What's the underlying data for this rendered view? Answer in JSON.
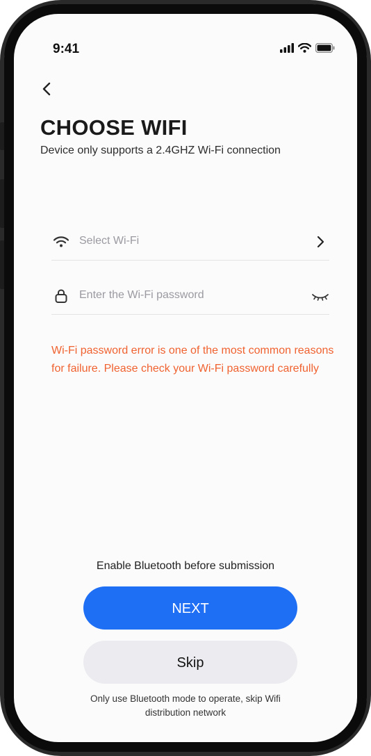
{
  "status_bar": {
    "time": "9:41",
    "icons": [
      "cellular-signal-icon",
      "wifi-icon",
      "battery-icon"
    ]
  },
  "header": {
    "back_icon": "chevron-left-icon",
    "title": "CHOOSE WIFI",
    "subtitle": "Device only supports a 2.4GHZ Wi-Fi connection"
  },
  "form": {
    "wifi_field": {
      "icon": "wifi-icon",
      "placeholder": "Select Wi-Fi",
      "right_icon": "chevron-right-icon"
    },
    "password_field": {
      "icon": "lock-icon",
      "placeholder": "Enter the Wi-Fi password",
      "right_icon": "eye-closed-icon"
    },
    "warning": "Wi-Fi password error is one of the most common reasons for failure. Please check your Wi-Fi password carefully"
  },
  "footer": {
    "bluetooth_note": "Enable Bluetooth before submission",
    "next_label": "NEXT",
    "skip_label": "Skip",
    "skip_note": "Only use Bluetooth mode to operate, skip Wifi distribution network"
  },
  "colors": {
    "accent": "#1f6ff5",
    "warning": "#f0622f",
    "secondary_button": "#ececf0"
  }
}
